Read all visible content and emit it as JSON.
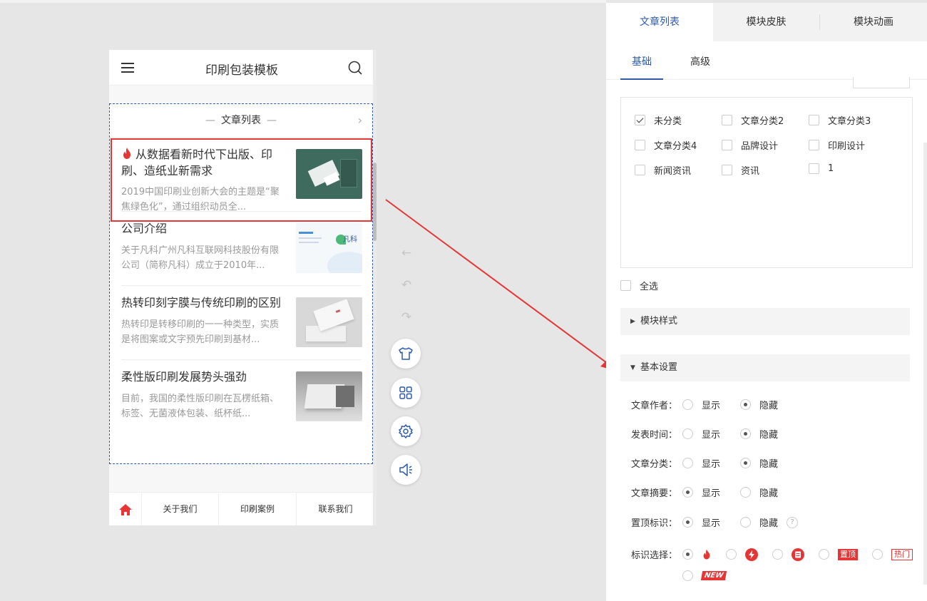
{
  "phone": {
    "title": "印刷包装模板",
    "module_title": "文章列表",
    "articles": [
      {
        "title": "从数据看新时代下出版、印刷、造纸业新需求",
        "desc": "2019中国印刷业创新大会的主题是“聚焦绿色化”，通过组织动员全..."
      },
      {
        "title": "公司介绍",
        "desc": "关于凡科广州凡科互联网科技股份有限公司（简称凡科）成立于2010年..."
      },
      {
        "title": "热转印刻字膜与传统印刷的区别",
        "desc": "热转印是转移印刷的一一种类型，实质是将图案或文字预先印刷到基材..."
      },
      {
        "title": "柔性版印刷发展势头强劲",
        "desc": "目前，我国的柔性版印刷在瓦楞纸箱、标签、无菌液体包装、纸杯纸..."
      }
    ],
    "footer": [
      "关于我们",
      "印刷案例",
      "联系我们"
    ]
  },
  "panel": {
    "tabs": [
      "文章列表",
      "模块皮肤",
      "模块动画"
    ],
    "subtabs": [
      "基础",
      "高级"
    ],
    "categories": [
      {
        "label": "未分类",
        "checked": true
      },
      {
        "label": "文章分类2",
        "checked": false
      },
      {
        "label": "文章分类3",
        "checked": false
      },
      {
        "label": "文章分类4",
        "checked": false
      },
      {
        "label": "品牌设计",
        "checked": false
      },
      {
        "label": "印刷设计",
        "checked": false
      },
      {
        "label": "新闻资讯",
        "checked": false
      },
      {
        "label": "资讯",
        "checked": false
      },
      {
        "label": "1",
        "checked": false
      }
    ],
    "select_all": "全选",
    "section_style": "模块样式",
    "section_basic": "基本设置",
    "show": "显示",
    "hide": "隐藏",
    "settings": [
      {
        "label": "文章作者：",
        "value": "hide"
      },
      {
        "label": "发表时间：",
        "value": "hide"
      },
      {
        "label": "文章分类：",
        "value": "hide"
      },
      {
        "label": "文章摘要：",
        "value": "show"
      },
      {
        "label": "置顶标识：",
        "value": "show"
      }
    ],
    "marker_label": "标识选择：",
    "marker_top": "置顶",
    "marker_hot": "热门",
    "marker_new": "NEW",
    "help": "?"
  },
  "colors": {
    "accent": "#2d5aa8",
    "red": "#e53535"
  }
}
